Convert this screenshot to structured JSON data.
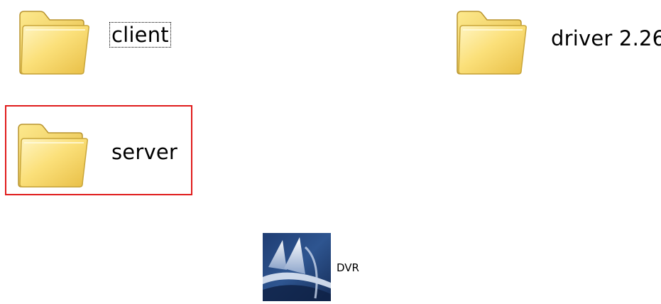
{
  "items": {
    "client": {
      "label": "client",
      "icon": "folder-icon"
    },
    "driver": {
      "label": "driver 2.26",
      "icon": "folder-icon"
    },
    "server": {
      "label": "server",
      "icon": "folder-icon"
    },
    "dvr": {
      "label": "DVR",
      "icon": "dvr-app-icon"
    }
  },
  "colors": {
    "folder_body": "#f7d86a",
    "folder_light": "#fff3b4",
    "folder_edge": "#c9a63a",
    "highlight": "#e01b1b",
    "dvr_dark": "#1f3d73",
    "dvr_light": "#6f8ab5"
  }
}
